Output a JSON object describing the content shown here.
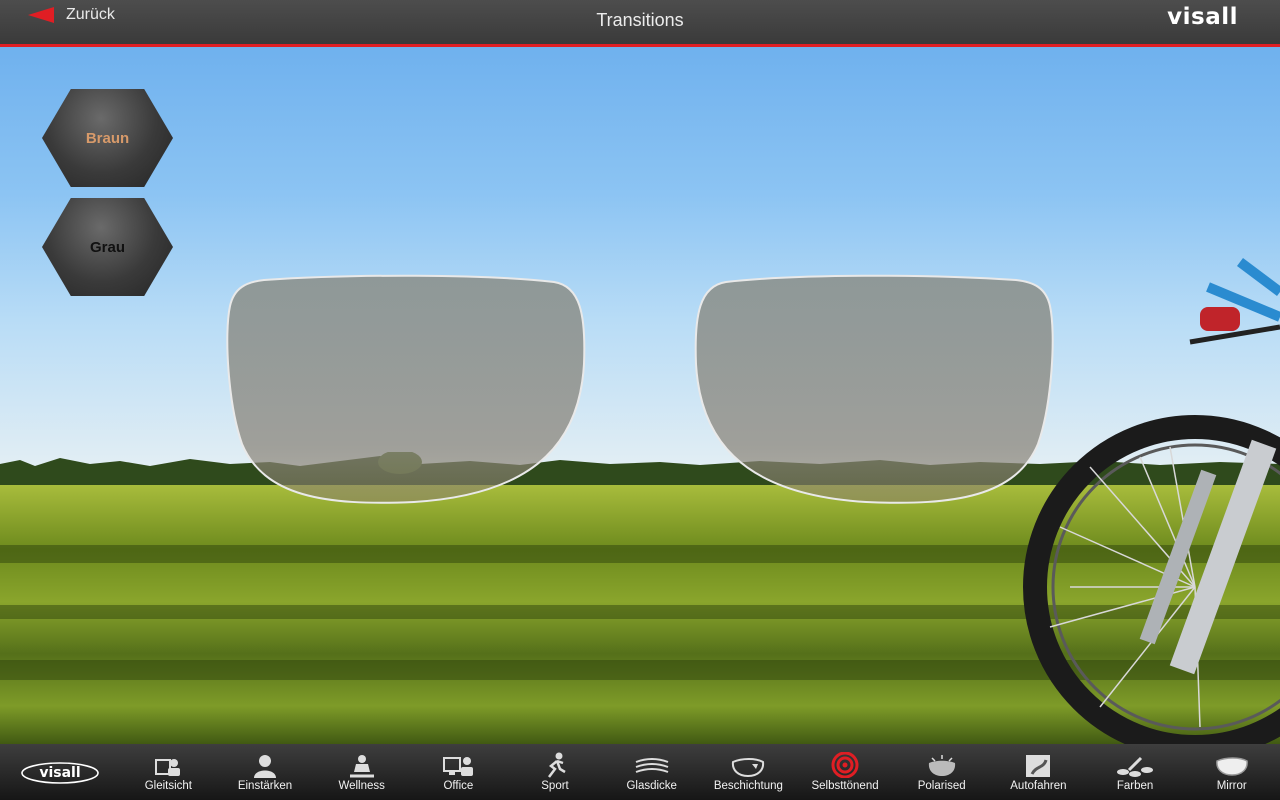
{
  "header": {
    "back_label": "Zurück",
    "title": "Transitions",
    "brand": "visall"
  },
  "tints": [
    {
      "label": "Braun",
      "selected": true
    },
    {
      "label": "Grau",
      "selected": false
    }
  ],
  "tabbar": {
    "logo": "visall",
    "items": [
      {
        "label": "Gleitsicht",
        "icon": "progressive-lens-icon"
      },
      {
        "label": "Einstärken",
        "icon": "person-icon"
      },
      {
        "label": "Wellness",
        "icon": "meditation-icon"
      },
      {
        "label": "Office",
        "icon": "office-icon"
      },
      {
        "label": "Sport",
        "icon": "running-icon"
      },
      {
        "label": "Glasdicke",
        "icon": "lens-thickness-icon"
      },
      {
        "label": "Beschichtung",
        "icon": "coating-icon"
      },
      {
        "label": "Selbsttönend",
        "icon": "self-tinting-icon",
        "active": true
      },
      {
        "label": "Polarised",
        "icon": "polarised-icon"
      },
      {
        "label": "Autofahren",
        "icon": "driving-icon"
      },
      {
        "label": "Farben",
        "icon": "colors-icon"
      },
      {
        "label": "Mirror",
        "icon": "mirror-icon"
      }
    ]
  },
  "colors": {
    "accent": "#e01e24",
    "tint_braun": "#d79a6a",
    "bar": "#2a2a2a"
  }
}
